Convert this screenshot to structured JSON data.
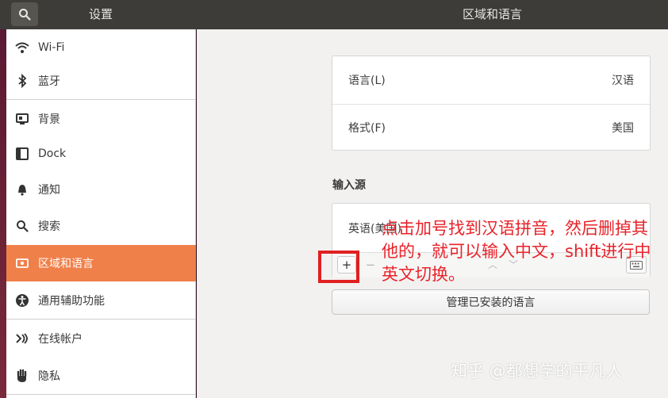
{
  "titlebar": {
    "left_title": "设置",
    "right_title": "区域和语言"
  },
  "sidebar": {
    "items": [
      {
        "label": "Wi-Fi",
        "icon": "wifi-icon"
      },
      {
        "label": "蓝牙",
        "icon": "bluetooth-icon"
      },
      {
        "label": "背景",
        "icon": "background-icon"
      },
      {
        "label": "Dock",
        "icon": "dock-icon"
      },
      {
        "label": "通知",
        "icon": "bell-icon"
      },
      {
        "label": "搜索",
        "icon": "search-icon"
      },
      {
        "label": "区域和语言",
        "icon": "region-icon",
        "active": true
      },
      {
        "label": "通用辅助功能",
        "icon": "accessibility-icon"
      },
      {
        "label": "在线帐户",
        "icon": "online-accounts-icon"
      },
      {
        "label": "隐私",
        "icon": "privacy-hand-icon"
      }
    ]
  },
  "region": {
    "language_label": "语言(L)",
    "language_value": "汉语",
    "format_label": "格式(F)",
    "format_value": "美国"
  },
  "input_sources": {
    "title": "输入源",
    "source_label": "英语(美国)",
    "add_label": "+",
    "remove_label": "−"
  },
  "manage_button": "管理已安装的语言",
  "annotation": "点击加号找到汉语拼音，然后删掉其他的，就可以输入中文，shift进行中英文切换。",
  "watermark": "知乎 @都想学的平凡人",
  "colors": {
    "accent": "#f0804a",
    "annotation": "#e8232a",
    "titlebar": "#3d3c38"
  }
}
